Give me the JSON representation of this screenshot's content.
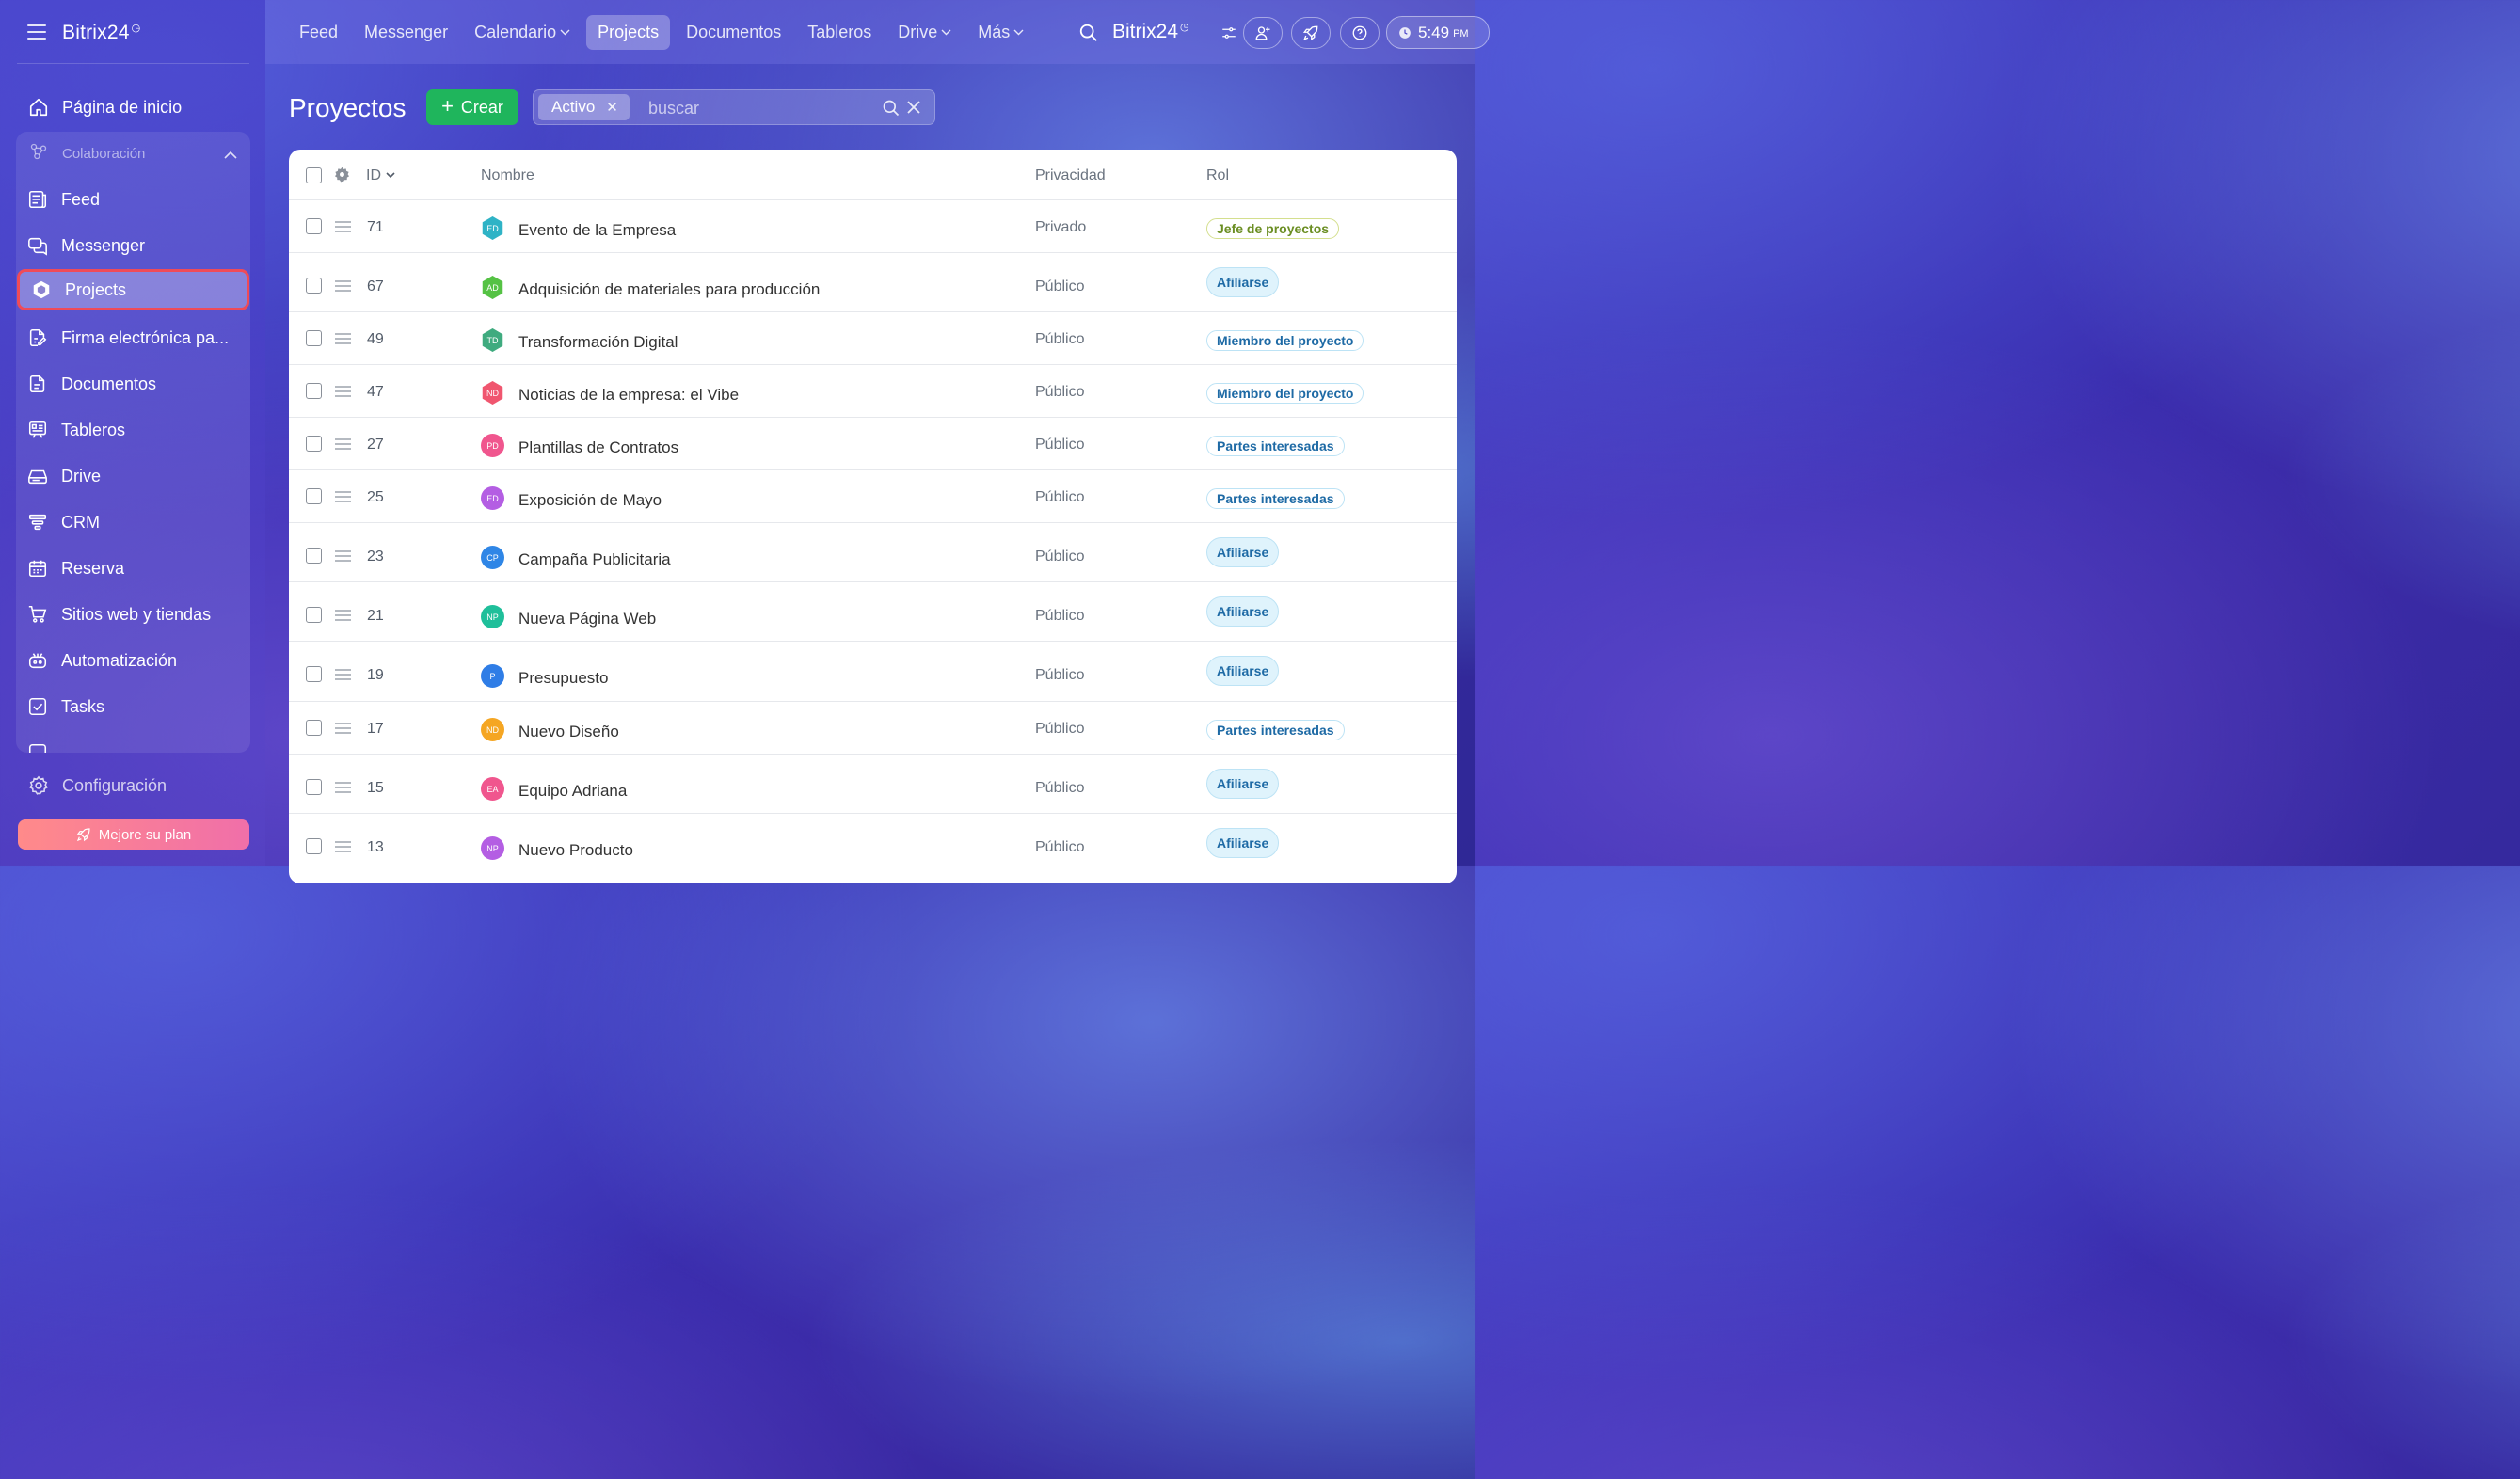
{
  "sidebar": {
    "logo": "Bitrix24",
    "home_label": "Página de inicio",
    "group_label": "Colaboración",
    "items": [
      {
        "label": "Feed",
        "icon": "feed-icon"
      },
      {
        "label": "Messenger",
        "icon": "chat-icon"
      },
      {
        "label": "Projects",
        "icon": "hexagon-icon",
        "active": true
      },
      {
        "label": "Firma electrónica pa...",
        "icon": "signature-icon"
      },
      {
        "label": "Documentos",
        "icon": "document-icon"
      },
      {
        "label": "Tableros",
        "icon": "board-icon"
      },
      {
        "label": "Drive",
        "icon": "drive-icon"
      },
      {
        "label": "CRM",
        "icon": "funnel-icon"
      },
      {
        "label": "Reserva",
        "icon": "calendar-icon"
      },
      {
        "label": "Sitios web y tiendas",
        "icon": "cart-icon"
      },
      {
        "label": "Automatización",
        "icon": "robot-icon"
      },
      {
        "label": "Tasks",
        "icon": "checkbox-icon"
      }
    ],
    "config_label": "Configuración",
    "upgrade_label": "Mejore su plan"
  },
  "topbar": {
    "nav": [
      {
        "label": "Feed"
      },
      {
        "label": "Messenger"
      },
      {
        "label": "Calendario",
        "dropdown": true
      },
      {
        "label": "Projects",
        "active": true
      },
      {
        "label": "Documentos"
      },
      {
        "label": "Tableros"
      },
      {
        "label": "Drive",
        "dropdown": true
      },
      {
        "label": "Más",
        "dropdown": true
      }
    ],
    "brand": "Bitrix24",
    "time": "5:49",
    "ampm": "PM"
  },
  "page": {
    "title": "Proyectos",
    "create_label": "Crear",
    "filter_chip": "Activo",
    "search_placeholder": "buscar"
  },
  "table": {
    "columns": {
      "id": "ID",
      "name": "Nombre",
      "privacy": "Privacidad",
      "role": "Rol"
    },
    "rows": [
      {
        "id": "71",
        "initials": "ED",
        "name": "Evento de la Empresa",
        "privacy": "Privado",
        "role": "Jefe de proyectos",
        "role_type": "boss",
        "avatar_color": "#2fb3c6",
        "avatar_shape": "hex"
      },
      {
        "id": "67",
        "initials": "AD",
        "name": "Adquisición de materiales para producción",
        "privacy": "Público",
        "role": "Afiliarse",
        "role_type": "join",
        "avatar_color": "#55c244",
        "avatar_shape": "hex"
      },
      {
        "id": "49",
        "initials": "TD",
        "name": "Transformación Digital",
        "privacy": "Público",
        "role": "Miembro del proyecto",
        "role_type": "member",
        "avatar_color": "#3fab7f",
        "avatar_shape": "hex"
      },
      {
        "id": "47",
        "initials": "ND",
        "name": "Noticias de la empresa: el Vibe",
        "privacy": "Público",
        "role": "Miembro del proyecto",
        "role_type": "member",
        "avatar_color": "#f0566f",
        "avatar_shape": "hex"
      },
      {
        "id": "27",
        "initials": "PD",
        "name": "Plantillas de Contratos",
        "privacy": "Público",
        "role": "Partes interesadas",
        "role_type": "member",
        "avatar_color": "#f0568e",
        "avatar_shape": "circle"
      },
      {
        "id": "25",
        "initials": "ED",
        "name": "Exposición de Mayo",
        "privacy": "Público",
        "role": "Partes interesadas",
        "role_type": "member",
        "avatar_color": "#b45ee3",
        "avatar_shape": "circle"
      },
      {
        "id": "23",
        "initials": "CP",
        "name": "Campaña Publicitaria",
        "privacy": "Público",
        "role": "Afiliarse",
        "role_type": "join",
        "avatar_color": "#2f86e6",
        "avatar_shape": "circle"
      },
      {
        "id": "21",
        "initials": "NP",
        "name": "Nueva Página Web",
        "privacy": "Público",
        "role": "Afiliarse",
        "role_type": "join",
        "avatar_color": "#1fbf9a",
        "avatar_shape": "circle"
      },
      {
        "id": "19",
        "initials": "P",
        "name": "Presupuesto",
        "privacy": "Público",
        "role": "Afiliarse",
        "role_type": "join",
        "avatar_color": "#2f7de6",
        "avatar_shape": "circle"
      },
      {
        "id": "17",
        "initials": "ND",
        "name": "Nuevo Diseño",
        "privacy": "Público",
        "role": "Partes interesadas",
        "role_type": "member",
        "avatar_color": "#f5a623",
        "avatar_shape": "circle"
      },
      {
        "id": "15",
        "initials": "EA",
        "name": "Equipo Adriana",
        "privacy": "Público",
        "role": "Afiliarse",
        "role_type": "join",
        "avatar_color": "#f0568e",
        "avatar_shape": "circle"
      },
      {
        "id": "13",
        "initials": "NP",
        "name": "Nuevo Producto",
        "privacy": "Público",
        "role": "Afiliarse",
        "role_type": "join",
        "avatar_color": "#b45ee3",
        "avatar_shape": "circle"
      }
    ]
  }
}
